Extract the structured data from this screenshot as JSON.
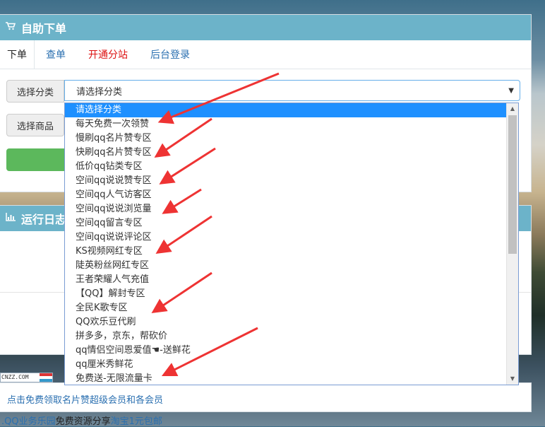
{
  "order_panel": {
    "title": "自助下单",
    "tabs": [
      {
        "label": "下单"
      },
      {
        "label": "查单"
      },
      {
        "label": "开通分站"
      },
      {
        "label": "后台登录"
      }
    ],
    "category_label": "选择分类",
    "category_value": "请选择分类",
    "product_label": "选择商品"
  },
  "log_panel": {
    "title": "运行日志"
  },
  "dropdown": {
    "options": [
      "请选择分类",
      "每天免费一次领赞",
      "慢刷qq名片赞专区",
      "快刷qq名片赞专区",
      "低价qq钻类专区",
      "空间qq说说赞专区",
      "空间qq人气访客区",
      "空间qq说说浏览量",
      "空间qq留言专区",
      "空间qq说说评论区",
      "KS视频网红专区",
      "陡英粉丝网红专区",
      "王者荣耀人气充值",
      "【QQ】解封专区",
      "全民K歌专区",
      "QQ欢乐豆代刷",
      "拼多多，京东，帮砍价",
      "qq情侣空间恩爱值☚-送鲜花",
      "qq厘米秀鲜花",
      "免费送-无限流量卡"
    ],
    "selected_index": 0
  },
  "cnzz_badge": "CNZZ.COM",
  "promo": {
    "link": "点击免费领取名片赞超级会员和各会员"
  },
  "bottom": {
    "link1": ".QQ业务乐园",
    "text1": "免费资源分享",
    "link2": "淘宝1元包邮"
  },
  "colors": {
    "panel_header": "#6cb3c9",
    "selected_option": "#1e90ff",
    "arrow": "#ee3333",
    "button_green": "#5cb85c",
    "tab_highlight": "#dd1111",
    "link": "#2a6fb0"
  },
  "icons": {
    "cart": "cart-icon",
    "chart": "bar-chart-icon",
    "caret": "caret-down-icon"
  }
}
